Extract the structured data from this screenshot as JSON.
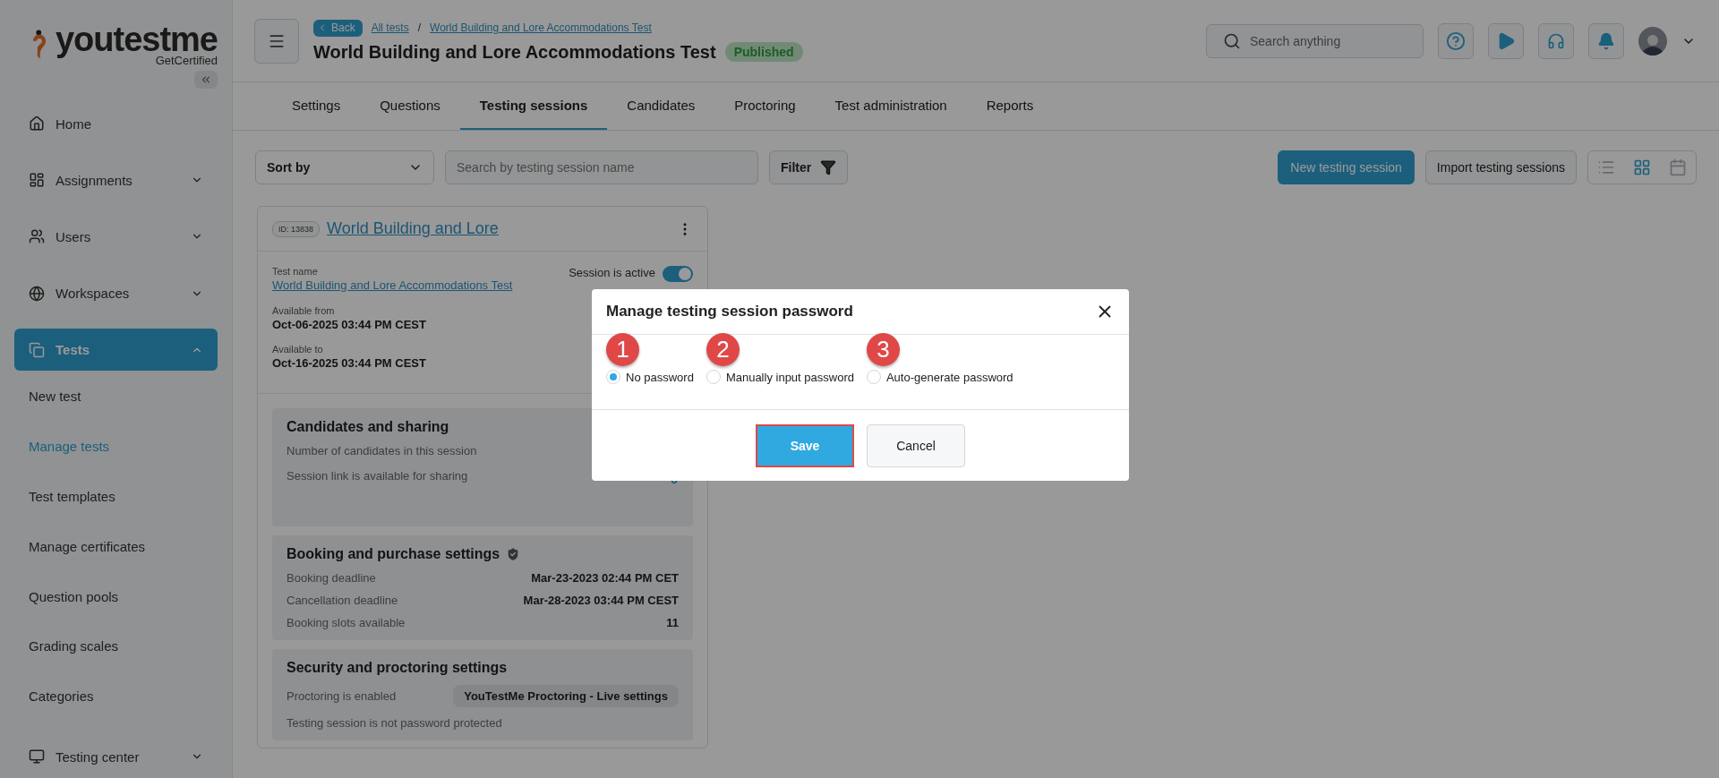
{
  "logo": {
    "name": "youtestme",
    "tagline": "GetCertified"
  },
  "sidebar": {
    "items": [
      {
        "label": "Home",
        "expandable": false,
        "selected": false
      },
      {
        "label": "Assignments",
        "expandable": true,
        "selected": false
      },
      {
        "label": "Users",
        "expandable": true,
        "selected": false
      },
      {
        "label": "Workspaces",
        "expandable": true,
        "selected": false
      },
      {
        "label": "Tests",
        "expandable": true,
        "selected": true,
        "children": [
          {
            "label": "New test",
            "selected": false
          },
          {
            "label": "Manage tests",
            "selected": true
          },
          {
            "label": "Test templates",
            "selected": false
          },
          {
            "label": "Manage certificates",
            "selected": false
          },
          {
            "label": "Question pools",
            "selected": false
          },
          {
            "label": "Grading scales",
            "selected": false
          },
          {
            "label": "Categories",
            "selected": false
          }
        ]
      },
      {
        "label": "Testing center",
        "expandable": true,
        "selected": false
      }
    ]
  },
  "header": {
    "back": "Back",
    "breadcrumbs": [
      "All tests",
      "World Building and Lore Accommodations Test"
    ],
    "separator": "/",
    "title": "World Building and Lore Accommodations Test",
    "status": "Published",
    "search_placeholder": "Search anything"
  },
  "tabs": [
    {
      "label": "Settings",
      "selected": false
    },
    {
      "label": "Questions",
      "selected": false
    },
    {
      "label": "Testing sessions",
      "selected": true
    },
    {
      "label": "Candidates",
      "selected": false
    },
    {
      "label": "Proctoring",
      "selected": false
    },
    {
      "label": "Test administration",
      "selected": false
    },
    {
      "label": "Reports",
      "selected": false
    }
  ],
  "toolbar": {
    "sort": "Sort by",
    "search_placeholder": "Search by testing session name",
    "filter": "Filter",
    "new": "New testing session",
    "import": "Import testing sessions",
    "views": [
      {
        "kind": "list",
        "selected": false
      },
      {
        "kind": "grid",
        "selected": true
      },
      {
        "kind": "calendar",
        "selected": false
      }
    ]
  },
  "session": {
    "id": "ID: 13838",
    "name": "World Building and Lore",
    "test_name_label": "Test name",
    "test_name": "World Building and Lore Accommodations Test",
    "active_label": "Session is active",
    "active": true,
    "available": [
      {
        "label": "Available from",
        "value": "Oct-06-2025 03:44 PM CEST"
      },
      {
        "label": "Available to",
        "value": "Oct-16-2025 03:44 PM CEST"
      }
    ],
    "sharing": {
      "title": "Candidates and sharing",
      "lines": [
        "Number of candidates in this session",
        "Session link is available for sharing"
      ]
    },
    "booking": {
      "title": "Booking and purchase settings",
      "rows": [
        {
          "label": "Booking deadline",
          "value": "Mar-23-2023 02:44 PM CET"
        },
        {
          "label": "Cancellation deadline",
          "value": "Mar-28-2023 03:44 PM CEST"
        },
        {
          "label": "Booking slots available",
          "value": "11"
        }
      ]
    },
    "security": {
      "title": "Security and proctoring settings",
      "proctoring_label": "Proctoring is enabled",
      "proctoring_button": "YouTestMe Proctoring - Live settings",
      "password_line": "Testing session is not password protected"
    }
  },
  "dialog": {
    "title": "Manage testing session password",
    "options": [
      {
        "label": "No password",
        "marker": "1",
        "selected": true
      },
      {
        "label": "Manually input password",
        "marker": "2",
        "selected": false
      },
      {
        "label": "Auto-generate password",
        "marker": "3",
        "selected": false
      }
    ],
    "save": "Save",
    "cancel": "Cancel",
    "save_highlighted": true
  }
}
